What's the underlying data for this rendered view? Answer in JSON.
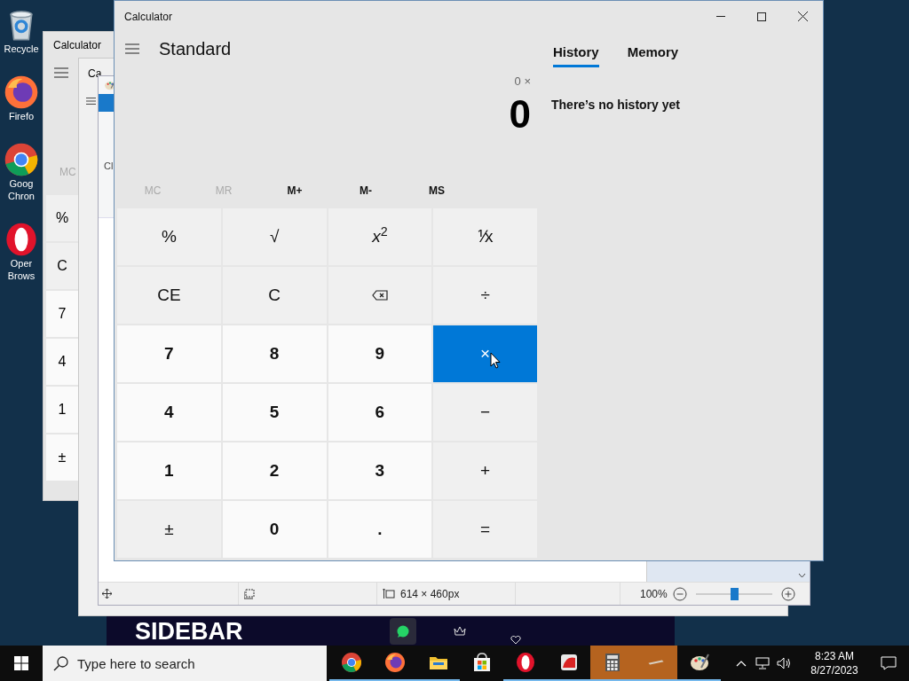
{
  "desktop_icons": [
    {
      "kind": "recycle",
      "lines": [
        "Recycle"
      ]
    },
    {
      "kind": "firefox",
      "lines": [
        "Firefo"
      ]
    },
    {
      "kind": "chrome",
      "lines": [
        "Goog",
        "Chron"
      ]
    },
    {
      "kind": "opera",
      "lines": [
        "Oper",
        "Brows"
      ]
    }
  ],
  "back_calculator": {
    "title": "Calculator",
    "memory": "MC",
    "keys": [
      "%",
      "C",
      "7",
      "4",
      "1",
      "±"
    ]
  },
  "middle_calculator": {
    "title": "Ca"
  },
  "paint": {
    "ribbon_text": "Cl",
    "status": {
      "size": "614 × 460px",
      "zoom": "100%",
      "zoom_slider": {
        "level": 0.5
      }
    }
  },
  "video_strip": {
    "title": "SIDEBAR"
  },
  "calculator": {
    "title": "Calculator",
    "mode": "Standard",
    "expression": "0 ×",
    "value": "0",
    "memory": [
      {
        "label": "MC",
        "disabled": true
      },
      {
        "label": "MR",
        "disabled": true
      },
      {
        "label": "M+",
        "disabled": false
      },
      {
        "label": "M-",
        "disabled": false
      },
      {
        "label": "MS",
        "disabled": false
      }
    ],
    "keys": [
      {
        "kind": "op",
        "label": "%",
        "hovered": false
      },
      {
        "kind": "op",
        "label": "√",
        "hovered": false
      },
      {
        "kind": "op",
        "label": "*x*$^{2}$",
        "hovered": false
      },
      {
        "kind": "op",
        "label": "⅟x",
        "hovered": false
      },
      {
        "kind": "op",
        "label": "CE",
        "hovered": false
      },
      {
        "kind": "op",
        "label": "C",
        "hovered": false
      },
      {
        "kind": "backspace",
        "hovered": false
      },
      {
        "kind": "op",
        "label": "÷",
        "hovered": false
      },
      {
        "kind": "num",
        "label": "7",
        "hovered": false
      },
      {
        "kind": "num",
        "label": "8",
        "hovered": false
      },
      {
        "kind": "num",
        "label": "9",
        "hovered": false
      },
      {
        "kind": "op",
        "label": "×",
        "hovered": true
      },
      {
        "kind": "num",
        "label": "4",
        "hovered": false
      },
      {
        "kind": "num",
        "label": "5",
        "hovered": false
      },
      {
        "kind": "num",
        "label": "6",
        "hovered": false
      },
      {
        "kind": "op",
        "label": "−",
        "hovered": false
      },
      {
        "kind": "num",
        "label": "1",
        "hovered": false
      },
      {
        "kind": "num",
        "label": "2",
        "hovered": false
      },
      {
        "kind": "num",
        "label": "3",
        "hovered": false
      },
      {
        "kind": "op",
        "label": "+",
        "hovered": false
      },
      {
        "kind": "op",
        "label": "±",
        "hovered": false
      },
      {
        "kind": "num",
        "label": "0",
        "hovered": false
      },
      {
        "kind": "num",
        "label": ".",
        "hovered": false
      },
      {
        "kind": "op",
        "label": "=",
        "hovered": false
      }
    ],
    "tabs": [
      {
        "label": "History",
        "selected": true
      },
      {
        "label": "Memory",
        "selected": false
      }
    ],
    "history_empty": "There’s no history yet"
  },
  "taskbar": {
    "search_placeholder": "Type here to search",
    "apps": [
      {
        "kind": "chrome",
        "running": true,
        "active": false
      },
      {
        "kind": "firefox",
        "running": true,
        "active": false
      },
      {
        "kind": "explorer",
        "running": true,
        "active": false
      },
      {
        "kind": "store",
        "running": false,
        "active": false
      },
      {
        "kind": "opera",
        "running": true,
        "active": false
      },
      {
        "kind": "reader",
        "running": true,
        "active": false
      },
      {
        "kind": "calculator",
        "running": true,
        "active": true
      },
      {
        "kind": "tool",
        "running": true,
        "active": true
      },
      {
        "kind": "paint",
        "running": true,
        "active": false
      }
    ],
    "time": "8:23 AM",
    "date": "8/27/2023"
  }
}
